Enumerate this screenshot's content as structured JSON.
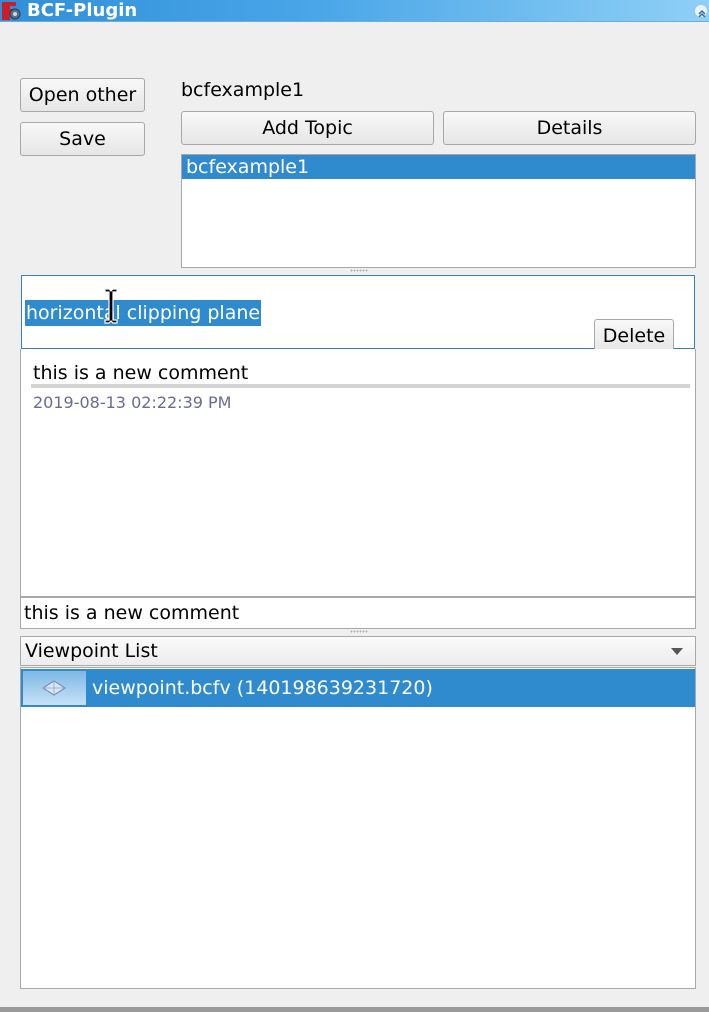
{
  "window": {
    "title": "BCF-Plugin"
  },
  "project": {
    "open_other_label": "Open other",
    "save_label": "Save",
    "current_file": "bcfexample1"
  },
  "topics": {
    "add_topic_label": "Add Topic",
    "details_label": "Details",
    "items": [
      {
        "label": "bcfexample1",
        "selected": true
      }
    ]
  },
  "topic": {
    "title": "horizontal clipping plane",
    "delete_label": "Delete"
  },
  "comments": {
    "items": [
      {
        "text": "this is a new comment",
        "date": "2019-08-13 02:22:39 PM"
      }
    ],
    "new_comment_value": "this is a new comment"
  },
  "viewpoints": {
    "selector_label": "Viewpoint List",
    "items": [
      {
        "label": "viewpoint.bcfv (140198639231720)",
        "selected": true
      }
    ]
  },
  "colors": {
    "selection": "#2f8bce",
    "titlebar_start": "#2f8fd8",
    "titlebar_end": "#8fd0f6",
    "date_text": "#6a6a96"
  },
  "icons": {
    "app": "freecad-app-icon",
    "collapse": "collapse-icon",
    "dropdown": "chevron-down-icon",
    "viewpoint_thumbnail": "viewpoint-thumbnail-icon",
    "text_cursor": "text-cursor-icon"
  }
}
